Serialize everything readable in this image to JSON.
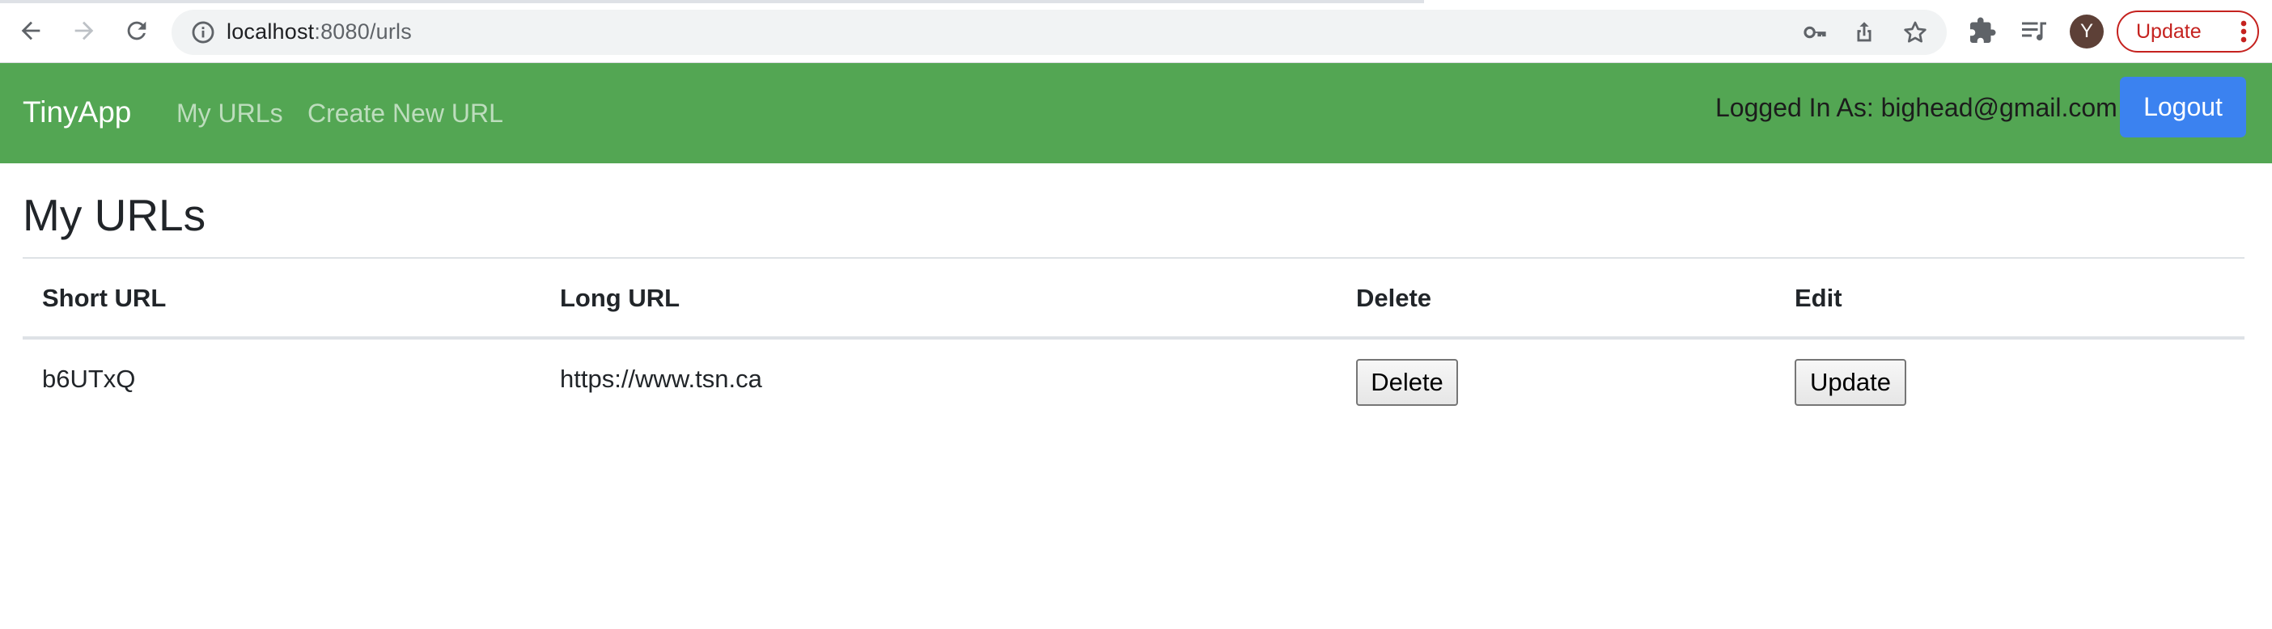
{
  "browser": {
    "url_host": "localhost",
    "url_rest": ":8080/urls",
    "profile_initial": "Y",
    "update_label": "Update",
    "icons": [
      "back-arrow-icon",
      "forward-arrow-icon",
      "reload-icon",
      "site-info-icon",
      "key-icon",
      "share-icon",
      "star-icon",
      "extensions-icon",
      "reading-list-icon",
      "kebab-menu-icon"
    ]
  },
  "navbar": {
    "brand": "TinyApp",
    "links": [
      "My URLs",
      "Create New URL"
    ],
    "logged_in_text": "Logged In As: bighead@gmail.com",
    "logout_label": "Logout",
    "color": "#53a653"
  },
  "main": {
    "title": "My URLs",
    "table": {
      "headers": [
        "Short URL",
        "Long URL",
        "Delete",
        "Edit"
      ],
      "rows": [
        {
          "short_url": "b6UTxQ",
          "long_url": "https://www.tsn.ca",
          "delete_label": "Delete",
          "edit_label": "Update"
        }
      ]
    }
  },
  "colors": {
    "accent": "#3b82f0",
    "update_chip": "#c5221f"
  }
}
